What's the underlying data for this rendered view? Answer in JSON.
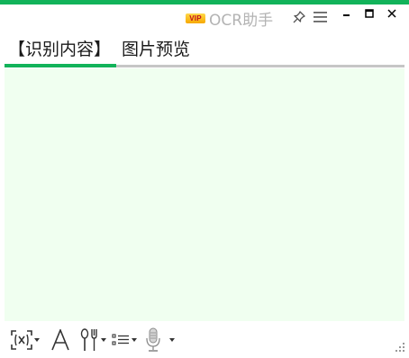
{
  "window": {
    "vip_badge": "VIP",
    "title": "OCR助手",
    "accent": "#12b35a",
    "content_bg": "#f0fff0"
  },
  "titlebar_controls": [
    "pin-icon",
    "menu-icon",
    "minimize-icon",
    "maximize-icon",
    "close-icon"
  ],
  "tabs": [
    {
      "label": "【识别内容】",
      "active": true
    },
    {
      "label": "图片预览",
      "active": false
    }
  ],
  "content": {
    "value": ""
  },
  "toolbar": {
    "tools": [
      "recognize-region-icon",
      "font-icon",
      "tools-icon",
      "list-format-icon",
      "microphone-icon"
    ]
  }
}
